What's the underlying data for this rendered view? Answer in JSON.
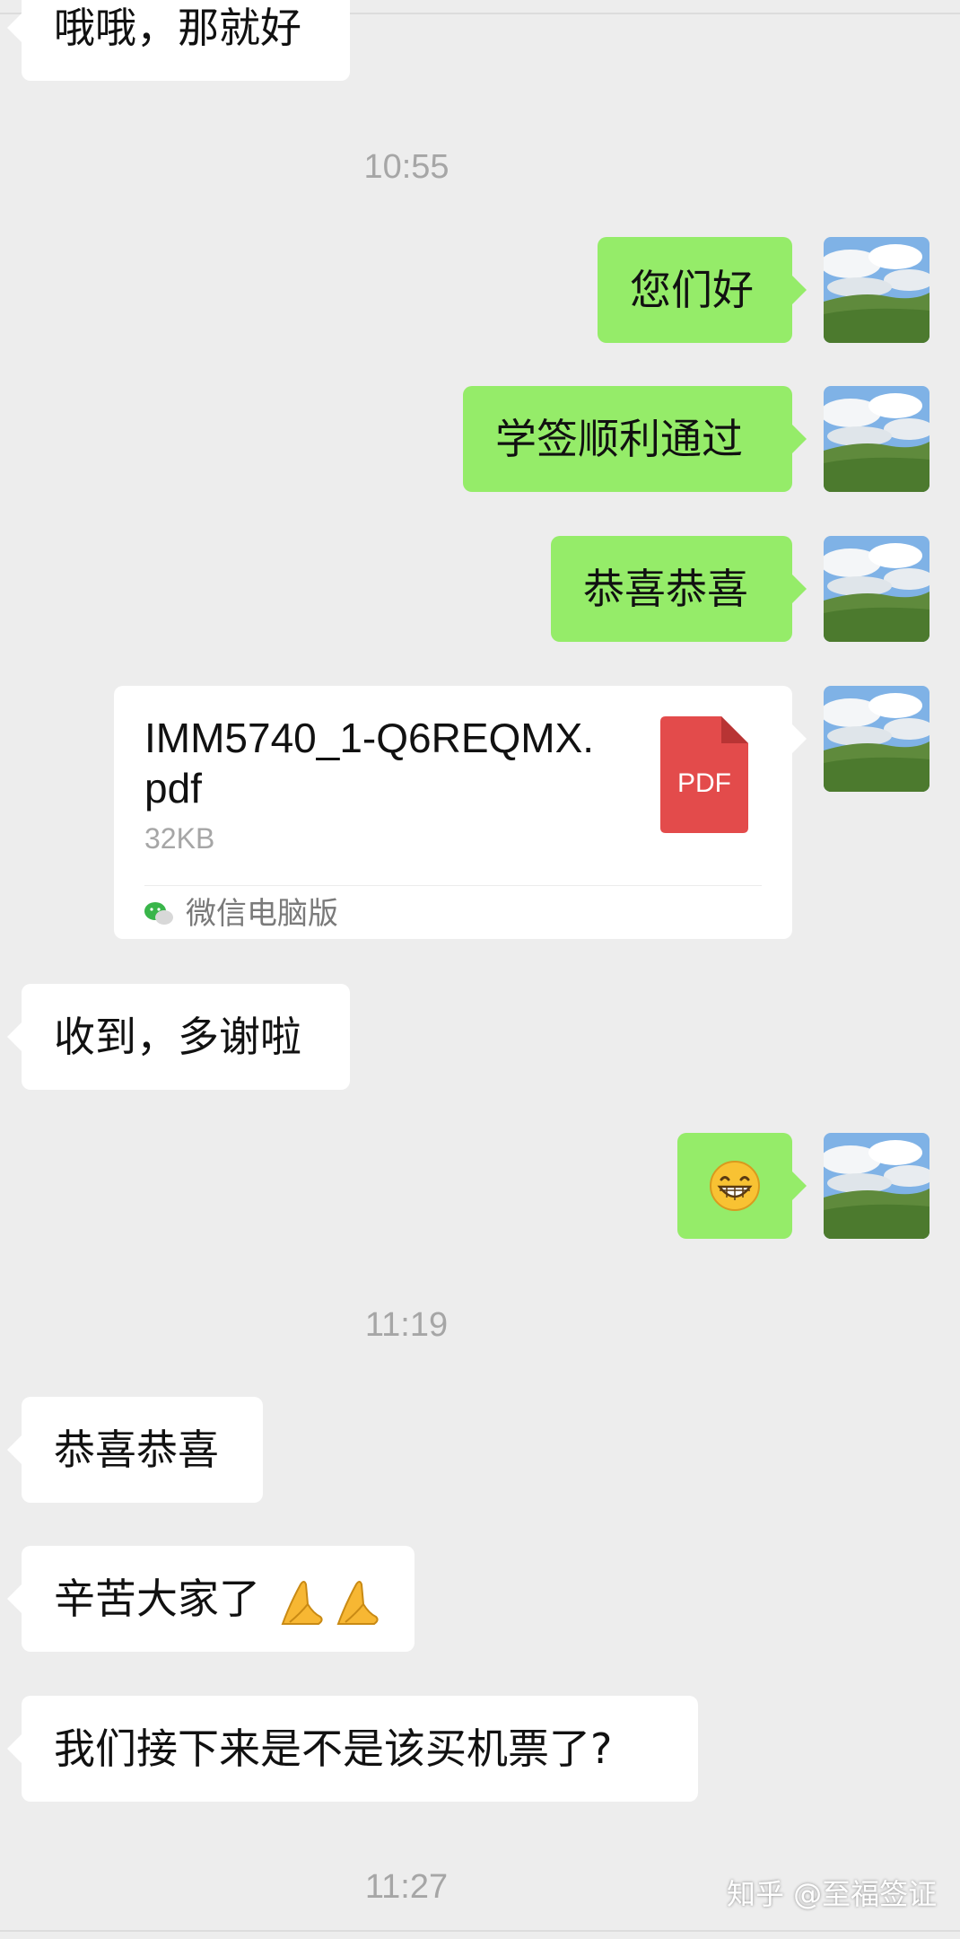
{
  "messages": [
    {
      "text": "哦哦，那就好"
    },
    {
      "time": "10:55"
    },
    {
      "text": "您们好"
    },
    {
      "text": "学签顺利通过"
    },
    {
      "text": "恭喜恭喜"
    },
    {
      "file": {
        "name": "IMM5740_1-Q6REQMX.pdf",
        "size": "32KB",
        "icon": "pdf-icon",
        "icon_label": "PDF",
        "source": "微信电脑版"
      }
    },
    {
      "text": "收到，多谢啦"
    },
    {
      "emoji": "grinning-face-emoji"
    },
    {
      "time": "11:19"
    },
    {
      "text": "恭喜恭喜"
    },
    {
      "text": "辛苦大家了",
      "emoji": "folded-hands-emoji"
    },
    {
      "text": "我们接下来是不是该买机票了?"
    },
    {
      "time": "11:27"
    }
  ],
  "watermark": "知乎 @至福签证",
  "colors": {
    "background": "#ededed",
    "outgoing_bubble": "#95ec69",
    "incoming_bubble": "#ffffff",
    "pdf_red": "#e34b4b"
  }
}
